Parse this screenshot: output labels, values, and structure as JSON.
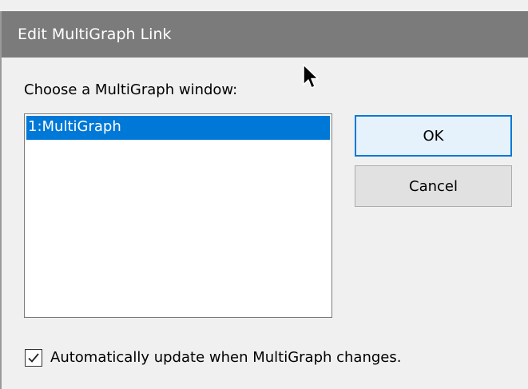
{
  "dialog": {
    "title": "Edit MultiGraph Link",
    "prompt_label": "Choose a MultiGraph window:",
    "list": {
      "items": [
        {
          "label": "1:MultiGraph",
          "selected": true
        }
      ]
    },
    "buttons": {
      "ok_label": "OK",
      "cancel_label": "Cancel"
    },
    "auto_update": {
      "label": "Automatically update when MultiGraph changes.",
      "checked": true
    }
  },
  "colors": {
    "titlebar": "#7b7b7b",
    "selection": "#0078d7",
    "dialog_background": "#f0f0f0",
    "default_button_border": "#0078d7"
  },
  "icons": {
    "cursor": "mouse-pointer-icon",
    "checkbox": "checkmark-icon"
  }
}
